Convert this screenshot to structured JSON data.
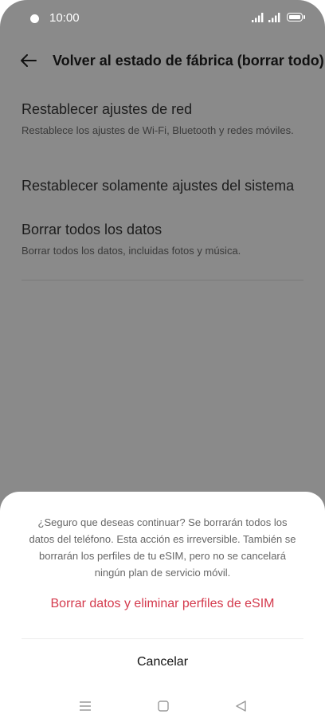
{
  "status_bar": {
    "time": "10:00",
    "icons": [
      "camera-dot-icon",
      "signal-icon",
      "signal-icon",
      "battery-icon"
    ]
  },
  "header": {
    "back_icon": "arrow-left-icon",
    "title": "Volver al estado de fábrica (borrar todo)"
  },
  "options": [
    {
      "title": "Restablecer ajustes de red",
      "subtitle": "Restablece los ajustes de Wi-Fi, Bluetooth y redes móviles."
    },
    {
      "title": "Restablecer solamente ajustes del sistema"
    },
    {
      "title": "Borrar todos los datos",
      "subtitle": "Borrar todos los datos, incluidas fotos y música."
    }
  ],
  "dialog": {
    "message": "¿Seguro que deseas continuar? Se borrarán todos los datos del teléfono. Esta acción es irreversible. También se borrarán los perfiles de tu eSIM, pero no se cancelará ningún plan de servicio móvil.",
    "confirm_label": "Borrar datos y eliminar perfiles de eSIM",
    "cancel_label": "Cancelar"
  },
  "nav_bar": {
    "icons": [
      "menu-icon",
      "home-icon",
      "back-triangle-icon"
    ]
  },
  "colors": {
    "scrim": "#8a8a8a",
    "danger": "#d43a4d",
    "sheet": "#ffffff"
  }
}
